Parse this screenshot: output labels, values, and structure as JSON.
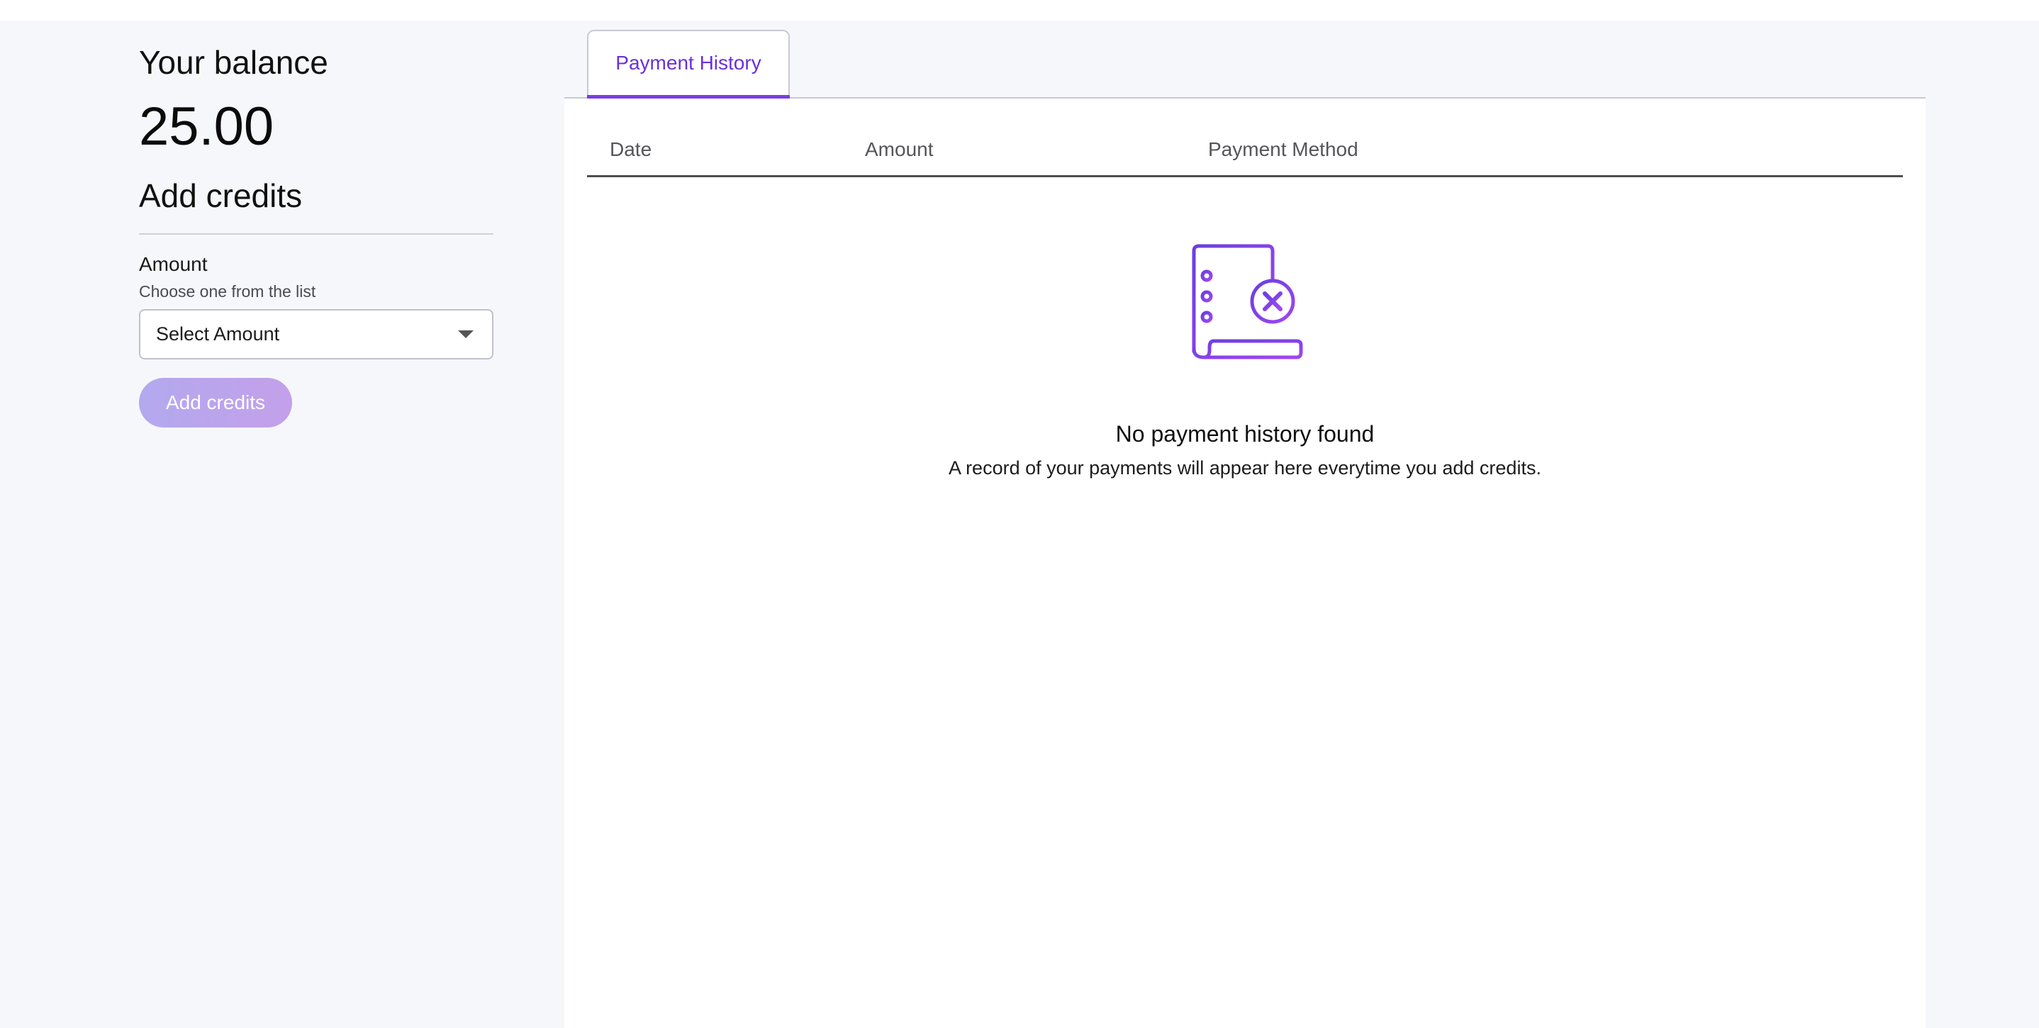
{
  "balance": {
    "title": "Your balance",
    "value": "25.00"
  },
  "add_credits": {
    "title": "Add credits",
    "amount_label": "Amount",
    "amount_help": "Choose one from the list",
    "select_placeholder": "Select Amount",
    "button_label": "Add credits"
  },
  "tabs": [
    {
      "label": "Payment History",
      "active": true
    }
  ],
  "table": {
    "columns": [
      "Date",
      "Amount",
      "Payment Method"
    ]
  },
  "empty_state": {
    "icon": "receipt-cancel-icon",
    "title": "No payment history found",
    "subtitle": "A record of your payments will appear here everytime you add credits."
  },
  "colors": {
    "accent": "#7a3ee4",
    "tab_text": "#6a31d8",
    "button_gradient_start": "#b3a9ee",
    "button_gradient_end": "#c3a0ea",
    "page_background": "#f6f7fb"
  }
}
